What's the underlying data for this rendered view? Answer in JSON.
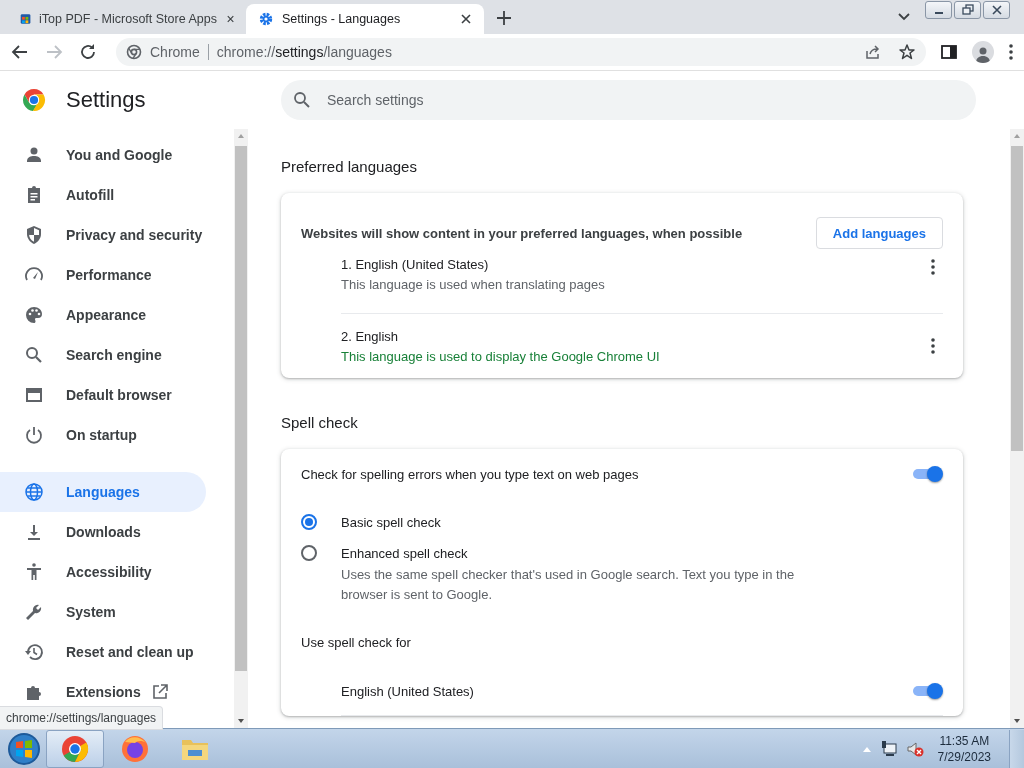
{
  "tabs": [
    {
      "title": "iTop PDF - Microsoft Store Apps",
      "selected": false
    },
    {
      "title": "Settings - Languages",
      "selected": true
    }
  ],
  "omnibox": {
    "site_label": "Chrome",
    "scheme": "chrome://",
    "host": "settings",
    "path": "/languages"
  },
  "settings_title": "Settings",
  "search": {
    "placeholder": "Search settings"
  },
  "sidebar": {
    "items": [
      {
        "label": "You and Google",
        "selected": false
      },
      {
        "label": "Autofill",
        "selected": false
      },
      {
        "label": "Privacy and security",
        "selected": false
      },
      {
        "label": "Performance",
        "selected": false
      },
      {
        "label": "Appearance",
        "selected": false
      },
      {
        "label": "Search engine",
        "selected": false
      },
      {
        "label": "Default browser",
        "selected": false
      },
      {
        "label": "On startup",
        "selected": false
      },
      {
        "label": "Languages",
        "selected": true
      },
      {
        "label": "Downloads",
        "selected": false
      },
      {
        "label": "Accessibility",
        "selected": false
      },
      {
        "label": "System",
        "selected": false
      },
      {
        "label": "Reset and clean up",
        "selected": false
      },
      {
        "label": "Extensions",
        "selected": false,
        "external": true
      }
    ]
  },
  "preferred_languages": {
    "heading": "Preferred languages",
    "description": "Websites will show content in your preferred languages, when possible",
    "add_button": "Add languages",
    "languages": [
      {
        "name": "1. English (United States)",
        "note": "This language is used when translating pages",
        "ui_language": false
      },
      {
        "name": "2. English",
        "note": "This language is used to display the Google Chrome UI",
        "ui_language": true
      }
    ]
  },
  "spell_check": {
    "heading": "Spell check",
    "toggle": {
      "label": "Check for spelling errors when you type text on web pages",
      "on": true
    },
    "options": [
      {
        "label": "Basic spell check",
        "selected": true
      },
      {
        "label": "Enhanced spell check",
        "description": "Uses the same spell checker that's used in Google search. Text you type in the browser is sent to Google.",
        "selected": false
      }
    ],
    "use_for_label": "Use spell check for",
    "languages": [
      {
        "name": "English (United States)",
        "on": true
      }
    ]
  },
  "status_bubble": "chrome://settings/languages",
  "taskbar": {
    "apps": [
      {
        "selected": true
      },
      {
        "selected": false
      },
      {
        "selected": false
      }
    ],
    "volume_muted": true,
    "time": "11:35 AM",
    "date": "7/29/2023"
  }
}
